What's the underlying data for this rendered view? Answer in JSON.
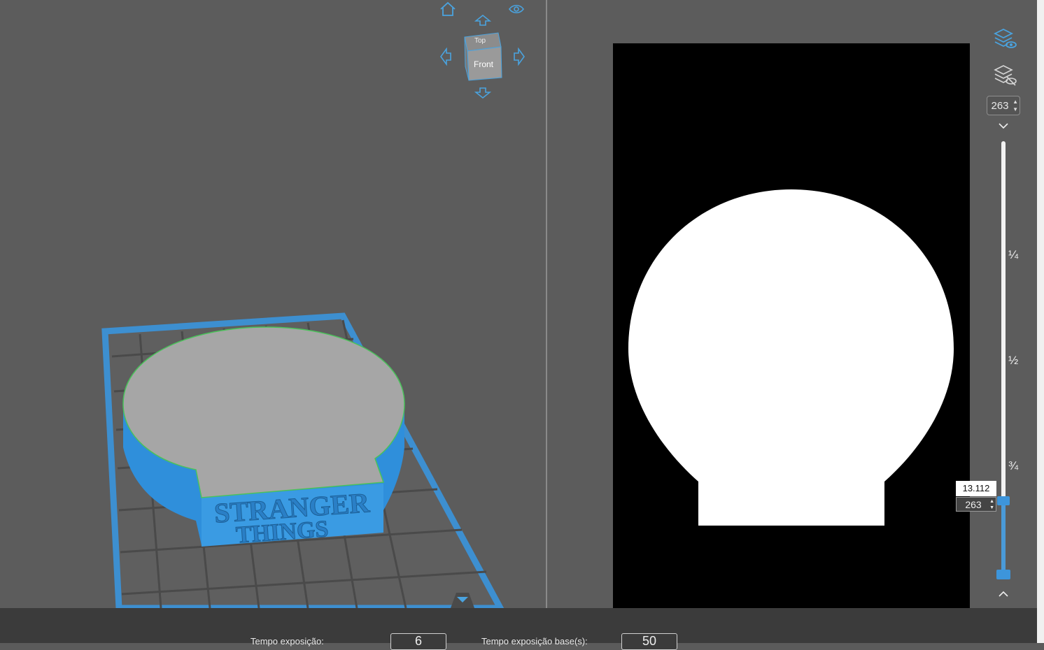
{
  "view_cube": {
    "top_label": "Top",
    "front_label": "Front"
  },
  "layer_panel": {
    "current_layer_top": "263",
    "fractions": [
      "¼",
      "½",
      "¾"
    ],
    "height_tooltip": "13.112",
    "current_layer_bottom": "263",
    "slider_level_fraction": 0.83
  },
  "model": {
    "label_line1": "STRANGER",
    "label_line2": "THINGS"
  },
  "bottom_bar": {
    "exposure_label": "Tempo exposição:",
    "exposure_value": "6",
    "base_exposure_label": "Tempo exposição base(s):",
    "base_exposure_value": "50"
  },
  "colors": {
    "accent": "#3d95db",
    "icon_blue": "#4aa3df",
    "model_blue": "#2f8fdb",
    "background": "#5c5c5c"
  }
}
